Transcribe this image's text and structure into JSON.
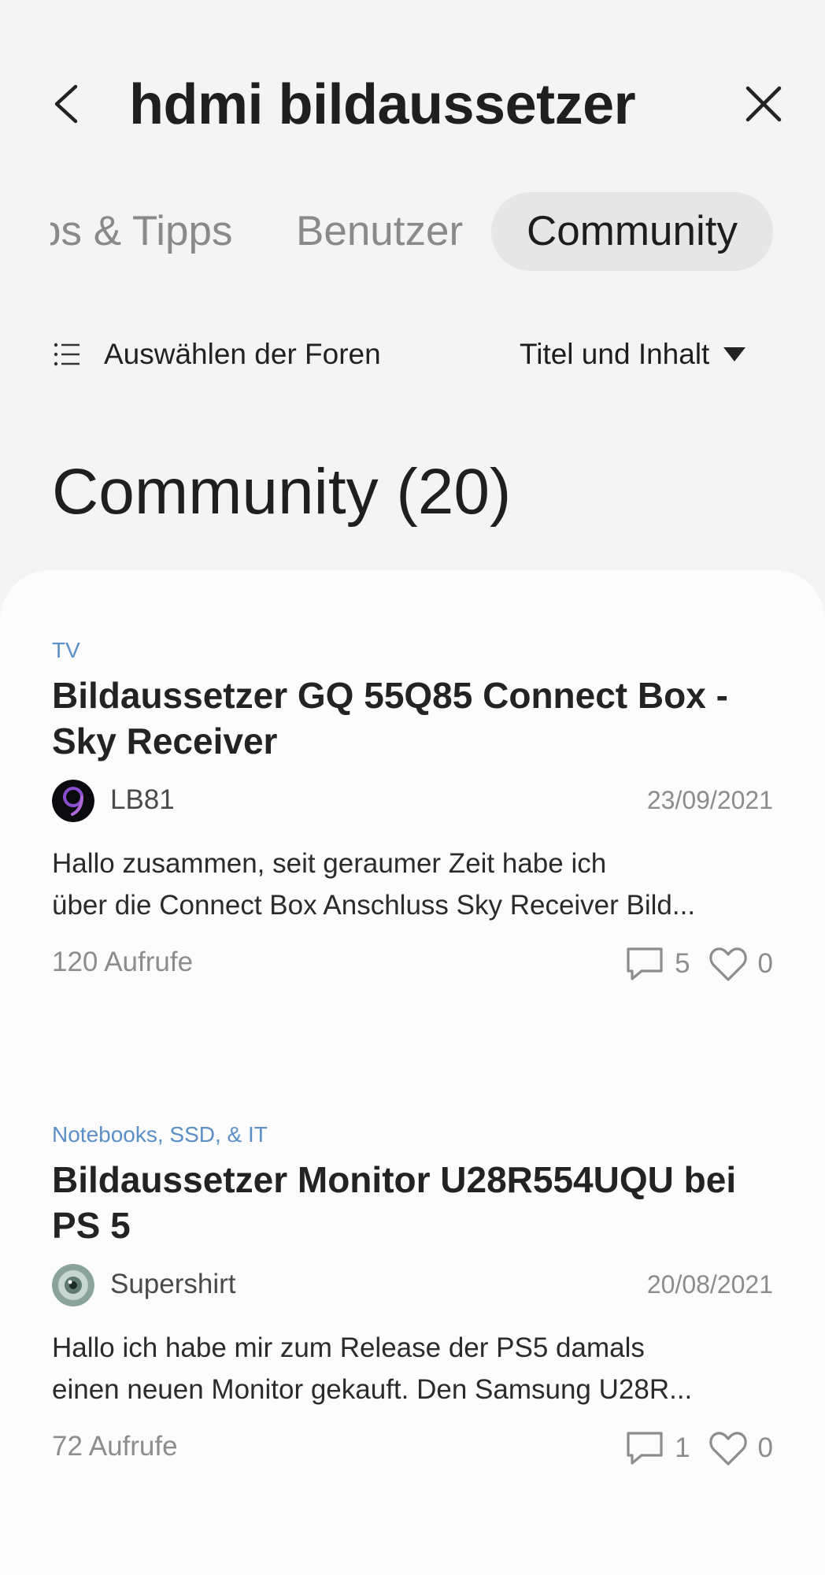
{
  "search": {
    "query": "hdmi bildaussetzer"
  },
  "tabs": [
    {
      "label": "ps & Tipps"
    },
    {
      "label": "Benutzer"
    },
    {
      "label": "Community"
    }
  ],
  "filters": {
    "forums_label": "Auswählen der Foren",
    "scope_label": "Titel und Inhalt"
  },
  "section": {
    "title": "Community (20)"
  },
  "posts": [
    {
      "category": "TV",
      "title": "Bildaussetzer GQ 55Q85 Connect Box - Sky Receiver",
      "author": "LB81",
      "date": "23/09/2021",
      "excerpt_line1": "Hallo zusammen, seit geraumer Zeit habe ich",
      "excerpt_line2": "über die Connect Box Anschluss Sky Receiver Bild...",
      "views": "120 Aufrufe",
      "comments": "5",
      "likes": "0"
    },
    {
      "category": "Notebooks, SSD, & IT",
      "title": "Bildaussetzer Monitor U28R554UQU bei PS 5",
      "author": "Supershirt",
      "date": "20/08/2021",
      "excerpt_line1": "Hallo ich habe mir zum Release der PS5 damals",
      "excerpt_line2": "einen neuen Monitor gekauft. Den Samsung U28R...",
      "views": "72 Aufrufe",
      "comments": "1",
      "likes": "0"
    }
  ],
  "colors": {
    "background": "#f4f4f5",
    "card": "#fcfcfd",
    "category": "#5b8fc5",
    "muted": "#8d8d8d",
    "active_tab_bg": "#e6e6e7"
  },
  "icons": {
    "back": "chevron-left-icon",
    "close": "close-icon",
    "forums": "list-icon",
    "scope": "caret-down-icon",
    "comments": "comment-icon",
    "likes": "heart-icon"
  }
}
